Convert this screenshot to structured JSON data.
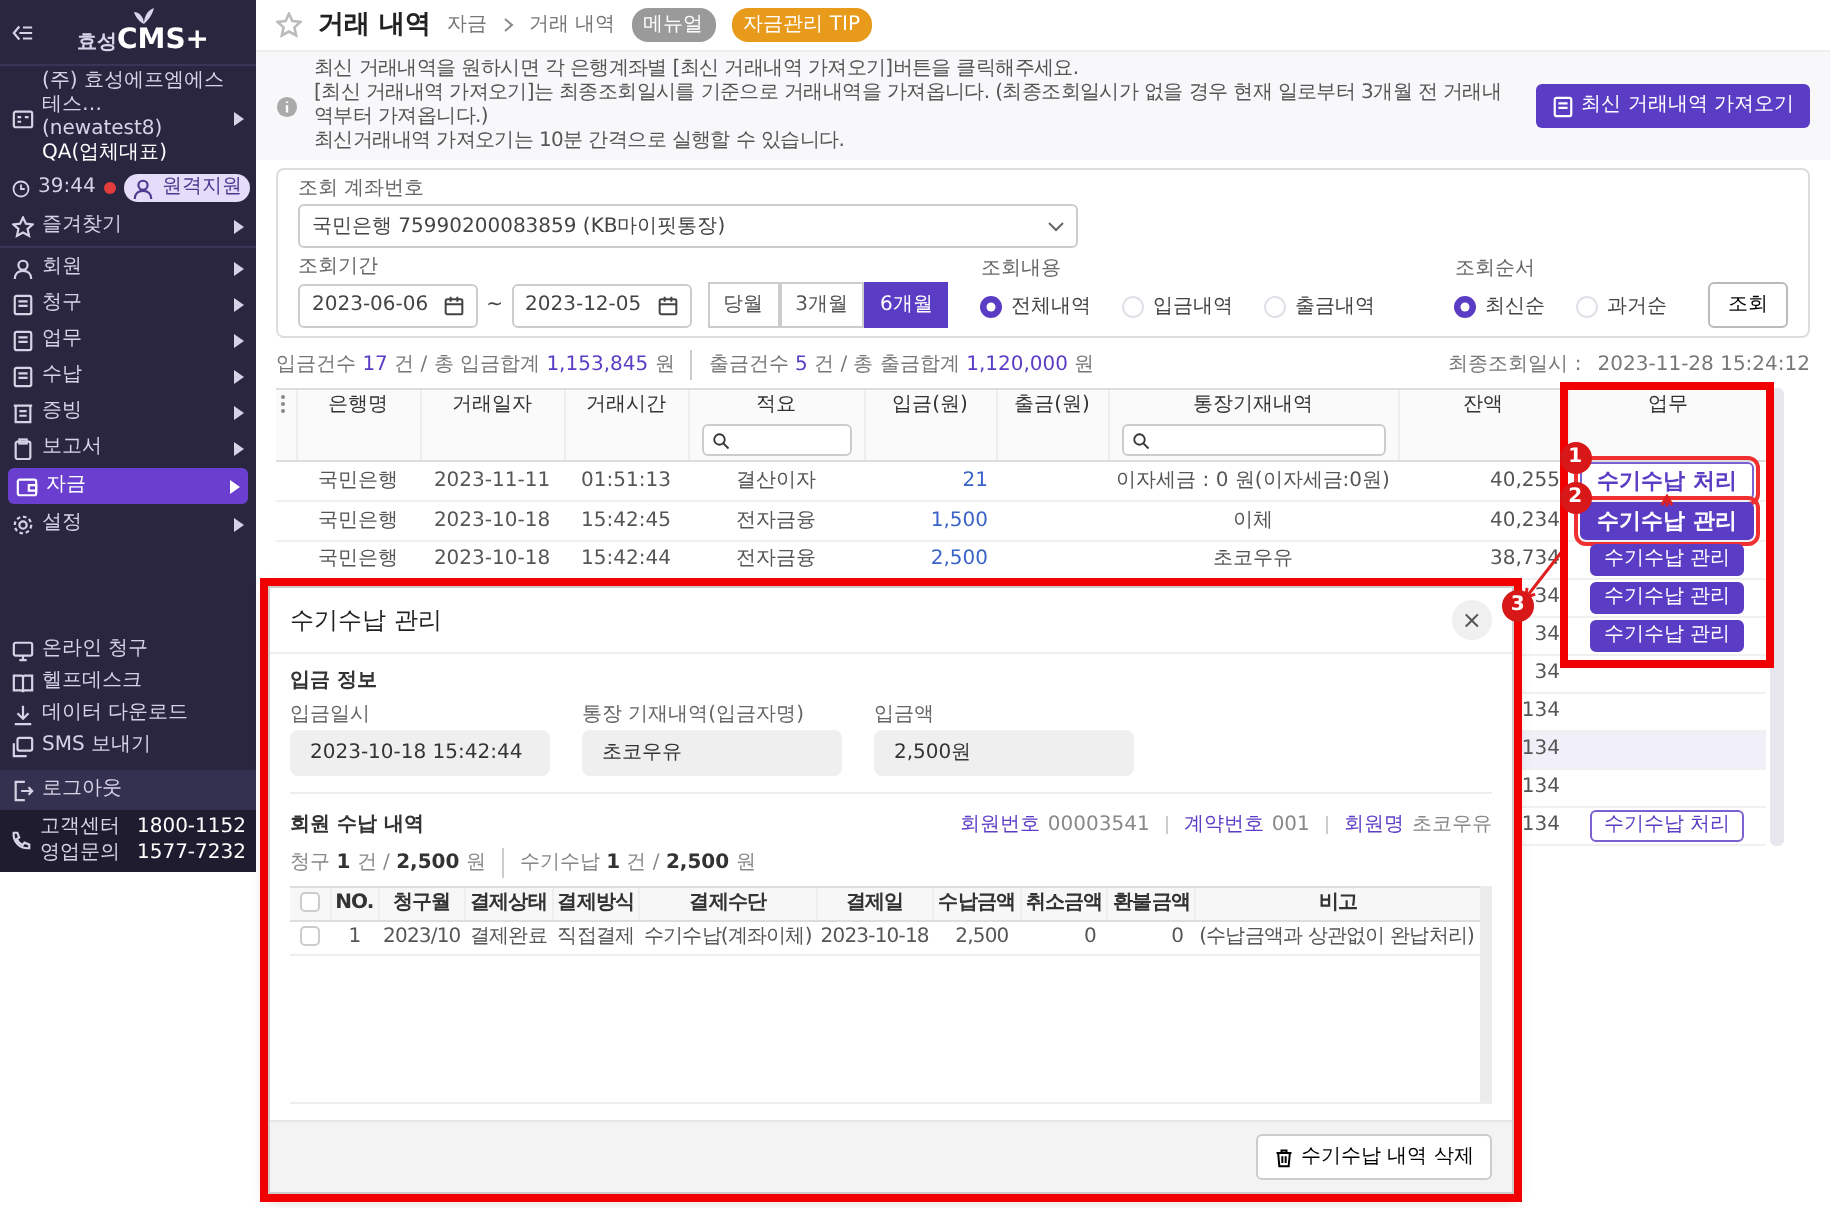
{
  "sidebar": {
    "logo_prefix": "효성",
    "logo_main": "CMS+",
    "company": "(주) 효성에프엠에스 테스…",
    "account": "(newatest8)",
    "role": "QA(업체대표)",
    "timer": "39:44",
    "remote_button": "원격지원",
    "favorites": "즐겨찾기",
    "menu": [
      {
        "label": "회원",
        "selected": false
      },
      {
        "label": "청구",
        "selected": false
      },
      {
        "label": "업무",
        "selected": false
      },
      {
        "label": "수납",
        "selected": false
      },
      {
        "label": "증빙",
        "selected": false
      },
      {
        "label": "보고서",
        "selected": false
      },
      {
        "label": "자금",
        "selected": true
      },
      {
        "label": "설정",
        "selected": false
      }
    ],
    "tools": [
      "온라인 청구",
      "헬프데스크",
      "데이터 다운로드",
      "SMS 보내기"
    ],
    "logout": "로그아웃",
    "contacts": [
      {
        "label": "고객센터",
        "number": "1800-1152"
      },
      {
        "label": "영업문의",
        "number": "1577-7232"
      }
    ]
  },
  "header": {
    "title": "거래 내역",
    "breadcrumb": [
      "자금",
      "거래 내역"
    ],
    "badges": [
      {
        "label": "메뉴얼",
        "kind": "manual"
      },
      {
        "label": "자금관리 TIP",
        "kind": "tip"
      }
    ]
  },
  "notice": {
    "lines": [
      "최신 거래내역을 원하시면 각 은행계좌별 [최신 거래내역 가져오기]버튼을 클릭해주세요.",
      "[최신 거래내역 가져오기]는 최종조회일시를 기준으로 거래내역을 가져옵니다. (최종조회일시가 없을 경우 현재 일로부터 3개월 전 거래내역부터 가져옵니다.)",
      "최신거래내역 가져오기는 10분 간격으로 실행할 수 있습니다."
    ],
    "button": "최신 거래내역 가져오기"
  },
  "search": {
    "account_label": "조회 계좌번호",
    "account": "국민은행 75990200083859 (KB마이핏통장)",
    "period_label": "조회기간",
    "date_from": "2023-06-06",
    "separator": "~",
    "date_to": "2023-12-05",
    "ranges": [
      {
        "label": "당월",
        "selected": false
      },
      {
        "label": "3개월",
        "selected": false
      },
      {
        "label": "6개월",
        "selected": true
      }
    ],
    "content_label": "조회내용",
    "content_options": [
      {
        "label": "전체내역",
        "selected": true
      },
      {
        "label": "입금내역",
        "selected": false
      },
      {
        "label": "출금내역",
        "selected": false
      }
    ],
    "order_label": "조회순서",
    "order_options": [
      {
        "label": "최신순",
        "selected": true
      },
      {
        "label": "과거순",
        "selected": false
      }
    ],
    "button": "조회"
  },
  "summary": {
    "deposit": "입금건수 **17** 건 / 총 입금합계 **1,153,845** 원",
    "withdrawal": "출금건수 **5** 건 / 총 출금합계 **1,120,000** 원",
    "last_query_label": "최종조회일시 :",
    "last_query": "2023-11-28 15:24:12"
  },
  "table": {
    "columns": [
      {
        "label": "은행명",
        "filter": false
      },
      {
        "label": "거래일자",
        "filter": false
      },
      {
        "label": "거래시간",
        "filter": false
      },
      {
        "label": "적요",
        "filter": true
      },
      {
        "label": "입금(원)",
        "filter": false
      },
      {
        "label": "출금(원)",
        "filter": false
      },
      {
        "label": "통장기재내역",
        "filter": true
      },
      {
        "label": "잔액",
        "filter": false
      },
      {
        "label": "업무",
        "filter": false
      }
    ],
    "rows": [
      {
        "bank": "국민은행",
        "date": "2023-11-11",
        "time": "01:51:13",
        "memo": "결산이자",
        "deposit": "21",
        "passbook": "이자세금 : 0 원(이자세금:0원)",
        "balance": "40,255",
        "selected": false,
        "action": {
          "label": "수기수납 처리",
          "kind": "process",
          "annotated": true
        }
      },
      {
        "bank": "국민은행",
        "date": "2023-10-18",
        "time": "15:42:45",
        "memo": "전자금융",
        "deposit": "1,500",
        "passbook": "이체",
        "balance": "40,234",
        "selected": false,
        "action": {
          "label": "수기수납 관리",
          "kind": "manage",
          "annotated": true
        }
      },
      {
        "bank": "국민은행",
        "date": "2023-10-18",
        "time": "15:42:44",
        "memo": "전자금융",
        "deposit": "2,500",
        "passbook": "초코우유",
        "balance": "38,734",
        "selected": false,
        "action": {
          "label": "수기수납 관리",
          "kind": "manage",
          "annotated": false
        }
      },
      {
        "balance": "34",
        "selected": false,
        "action": {
          "label": "수기수납 관리",
          "kind": "manage",
          "annotated": false
        }
      },
      {
        "balance": "34",
        "selected": false,
        "action": {
          "label": "수기수납 관리",
          "kind": "manage",
          "annotated": false
        }
      },
      {
        "balance": "34",
        "selected": false
      },
      {
        "balance": "134",
        "selected": false
      },
      {
        "balance": "134",
        "selected": true
      },
      {
        "balance": "134",
        "selected": false
      },
      {
        "balance": "134",
        "selected": false,
        "action": {
          "label": "수기수납 처리",
          "kind": "process",
          "annotated": false
        }
      }
    ]
  },
  "modal": {
    "title": "수기수납 관리",
    "close": "×",
    "section1": "입금 정보",
    "fields": [
      {
        "label": "입금일시",
        "value": "2023-10-18 15:42:44"
      },
      {
        "label": "통장 기재내역(입금자명)",
        "value": "초코우유"
      },
      {
        "label": "입금액",
        "value": "2,500원"
      }
    ],
    "section2": "회원 수납 내역",
    "meta": [
      {
        "label": "회원번호",
        "value": "00003541"
      },
      {
        "label": "계약번호",
        "value": "001"
      },
      {
        "label": "회원명",
        "value": "초코우유"
      }
    ],
    "counts": [
      "청구 **1** 건 / **2,500** 원",
      "수기수납 **1** 건 / **2,500** 원"
    ],
    "all_checked": false,
    "columns": [
      "NO.",
      "청구월",
      "결제상태",
      "결제방식",
      "결제수단",
      "결제일",
      "수납금액",
      "취소금액",
      "환불금액",
      "비고"
    ],
    "rows": [
      {
        "checked": false,
        "cells": [
          "1",
          "2023/10",
          "결제완료",
          "직접결제",
          "수기수납(계좌이체)",
          "2023-10-18",
          "2,500",
          "0",
          "0",
          "(수납금액과 상관없이 완납처리)"
        ]
      }
    ],
    "delete_button": "수기수납 내역 삭제"
  },
  "annotations": [
    {
      "label": "1"
    },
    {
      "label": "2"
    },
    {
      "label": "3"
    }
  ]
}
